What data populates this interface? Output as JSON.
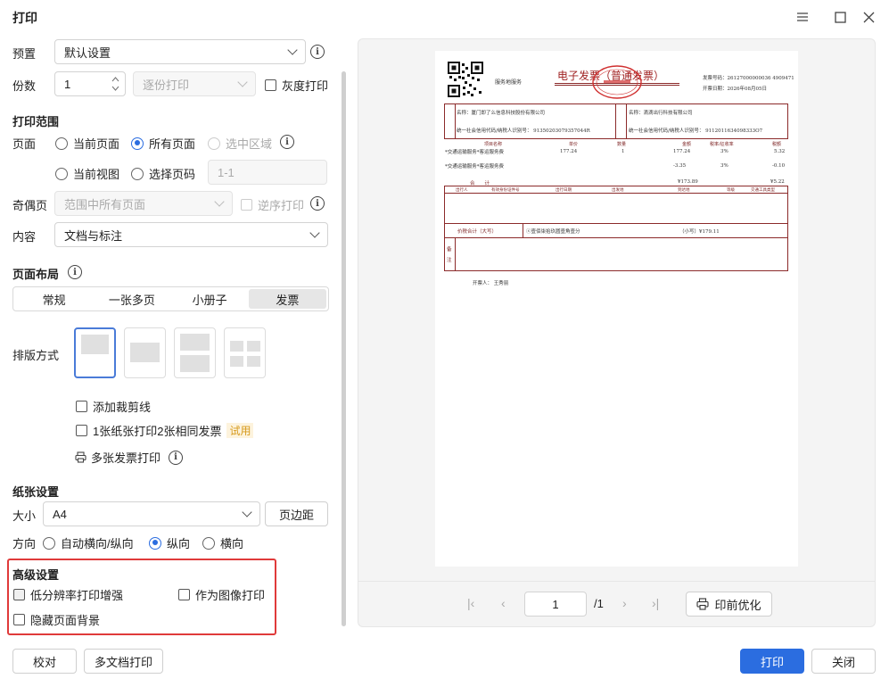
{
  "window": {
    "title": "打印"
  },
  "preset": {
    "label": "预置",
    "value": "默认设置"
  },
  "copies": {
    "label": "份数",
    "value": "1",
    "collate": "逐份打印",
    "grayscale": "灰度打印"
  },
  "range": {
    "heading": "打印范围",
    "pages_label": "页面",
    "current_page": "当前页面",
    "all_pages": "所有页面",
    "selection": "选中区域",
    "current_view": "当前视图",
    "select_pages": "选择页码",
    "pages_input_placeholder": "1-1",
    "odd_even_label": "奇偶页",
    "odd_even_value": "范围中所有页面",
    "reverse": "逆序打印",
    "content_label": "内容",
    "content_value": "文档与标注"
  },
  "layout": {
    "heading": "页面布局",
    "tabs": [
      "常规",
      "一张多页",
      "小册子",
      "发票"
    ],
    "active_tab": "发票",
    "arrange_label": "排版方式",
    "add_cut_line": "添加裁剪线",
    "two_per_sheet": "1张纸张打印2张相同发票",
    "trial_tag": "试用",
    "multi_invoice": "多张发票打印"
  },
  "paper": {
    "heading": "纸张设置",
    "size_label": "大小",
    "size_value": "A4",
    "margins_button": "页边距",
    "orientation_label": "方向",
    "auto": "自动横向/纵向",
    "portrait": "纵向",
    "landscape": "横向"
  },
  "advanced": {
    "heading": "高级设置",
    "low_res": "低分辨率打印增强",
    "as_image": "作为图像打印",
    "hide_bg": "隐藏页面背景"
  },
  "footer": {
    "proof": "校对",
    "multi_doc": "多文档打印",
    "print": "打印",
    "close": "关闭"
  },
  "pager": {
    "page": "1",
    "total": "/1",
    "optimize": "印前优化"
  },
  "invoice": {
    "service": "服务地服务",
    "title": "电子发票（普通发票）",
    "no_label": "发票号码：",
    "no_value": "26127000000036 4909471",
    "date_label": "开票日期：",
    "date_value": "2026年08月05日",
    "buyer_name": "名称：厦门即了么信息科技股份有限公司",
    "buyer_tax": "统一社会信用代码/纳税人识别号：  91350203079357044R",
    "seller_name": "名称：滴滴出行科技有限公司",
    "seller_tax": "统一社会信用代码/纳税人识别号：  9112011634098333O7",
    "cols": [
      "项目名称",
      "单价",
      "数量",
      "金额",
      "税率/征收率",
      "税额"
    ],
    "row1": [
      "*交通运输服务*客运服务费",
      "177.24",
      "1",
      "177.24",
      "3%",
      "5.32"
    ],
    "row2": [
      "*交通运输服务*客运服务费",
      "",
      "",
      "-3.35",
      "3%",
      "-0.10"
    ],
    "total_label": "合　　计",
    "total_amount": "¥173.89",
    "total_tax": "¥5.22",
    "trip_cols": [
      "出行人",
      "有效身份证件号",
      "出行日期",
      "出发地",
      "到达地",
      "等级",
      "交通工具类型"
    ],
    "grand_label": "价税合计（大写）",
    "grand_upper": "ⓧ壹佰柒拾玖圆壹角壹分",
    "grand_lower": "（小写）¥179.11",
    "remark": "备注",
    "issuer": "开票人：  王秀丽"
  }
}
